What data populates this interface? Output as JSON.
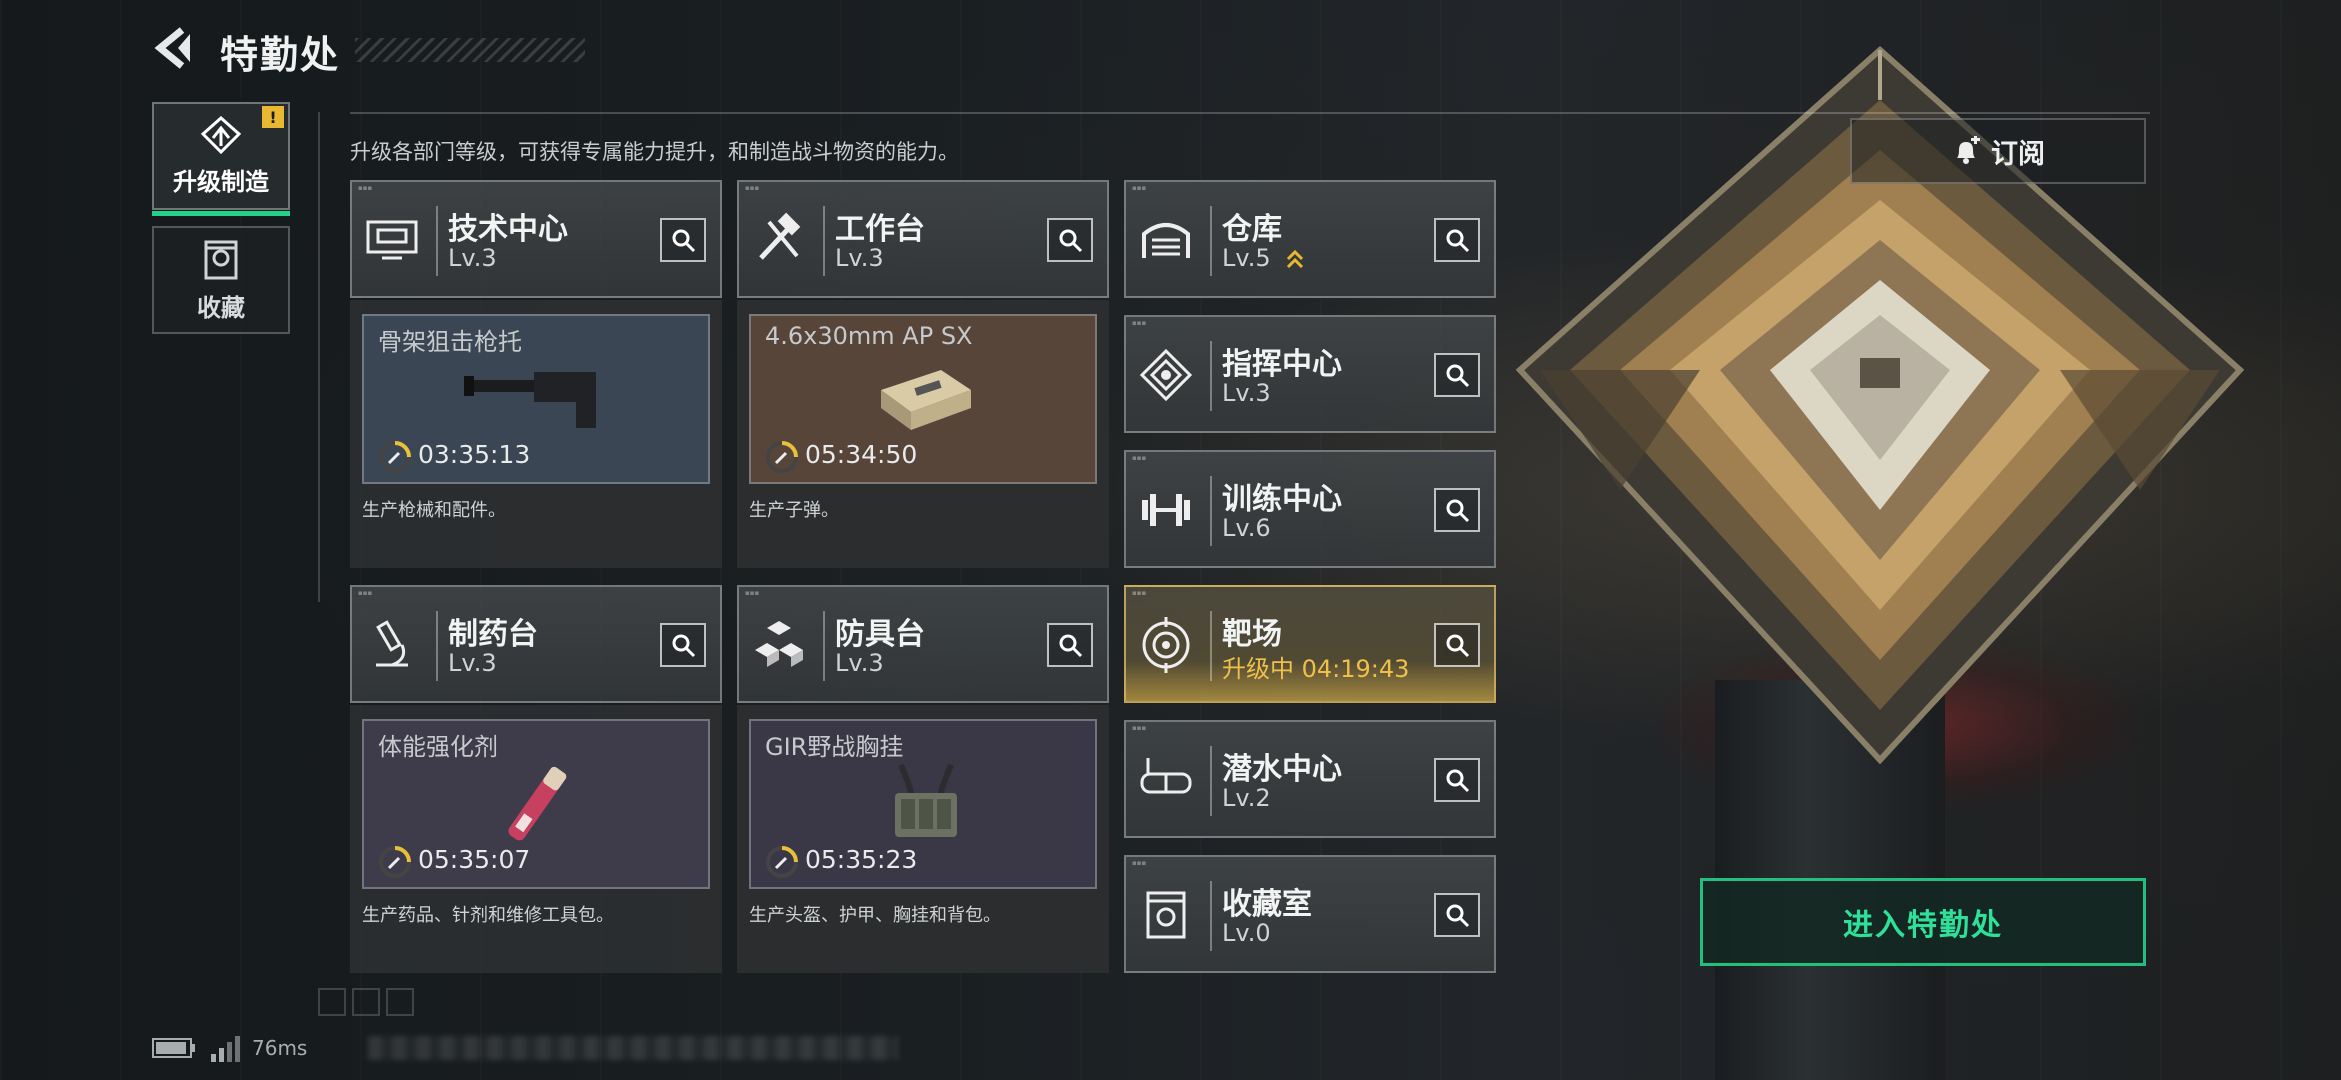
{
  "header": {
    "title": "特勤处",
    "subtitle": "升级各部门等级，可获得专属能力提升，和制造战斗物资的能力。"
  },
  "tabs": [
    {
      "label": "升级制造",
      "selected": true,
      "alert": "!"
    },
    {
      "label": "收藏",
      "selected": false
    }
  ],
  "departments": [
    {
      "name": "技术中心",
      "level": "Lv.3",
      "icon": "tech-center-icon"
    },
    {
      "name": "工作台",
      "level": "Lv.3",
      "icon": "workbench-icon"
    },
    {
      "name": "仓库",
      "level": "Lv.5",
      "icon": "warehouse-icon",
      "upgradable": true
    },
    {
      "name": "指挥中心",
      "level": "Lv.3",
      "icon": "command-center-icon"
    },
    {
      "name": "训练中心",
      "level": "Lv.6",
      "icon": "training-center-icon"
    },
    {
      "name": "制药台",
      "level": "Lv.3",
      "icon": "pharmacy-icon"
    },
    {
      "name": "防具台",
      "level": "Lv.3",
      "icon": "armor-bench-icon"
    },
    {
      "name": "靶场",
      "level": "升级中 04:19:43",
      "icon": "shooting-range-icon",
      "upgrading": true
    },
    {
      "name": "潜水中心",
      "level": "Lv.2",
      "icon": "diving-center-icon"
    },
    {
      "name": "收藏室",
      "level": "Lv.0",
      "icon": "collection-room-icon"
    }
  ],
  "production": [
    {
      "item": "骨架狙击枪托",
      "timer": "03:35:13",
      "desc": "生产枪械和配件。",
      "tint": "#3a4653"
    },
    {
      "item": "4.6x30mm AP SX",
      "timer": "05:34:50",
      "desc": "生产子弹。",
      "tint": "#57453a"
    },
    {
      "item": "体能强化剂",
      "timer": "05:35:07",
      "desc": "生产药品、针剂和维修工具包。",
      "tint": "#3e3b4a"
    },
    {
      "item": "GIR野战胸挂",
      "timer": "05:35:23",
      "desc": "生产头盔、护甲、胸挂和背包。",
      "tint": "#3a3846"
    }
  ],
  "actions": {
    "subscribe": "订阅",
    "enter": "进入特勤处"
  },
  "status": {
    "ping": "76ms"
  },
  "colors": {
    "accent_green": "#22d28b",
    "upgrading_gold": "#f0c04a",
    "alert_yellow": "#e8b832"
  }
}
